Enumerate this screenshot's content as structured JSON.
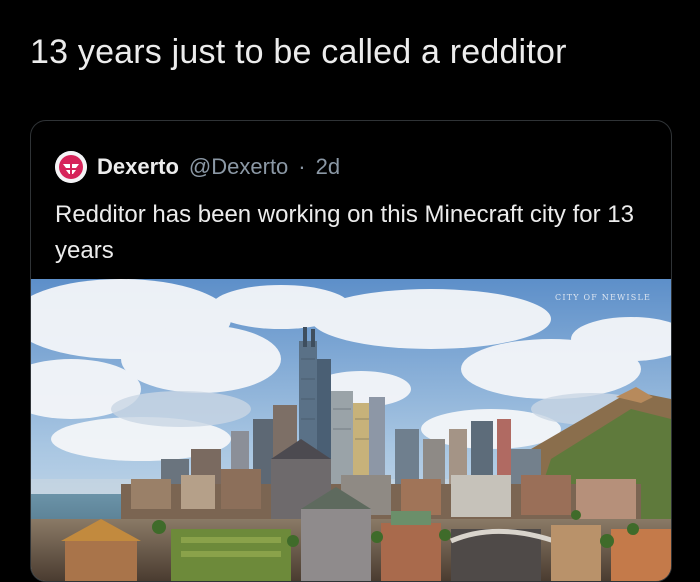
{
  "tweet": {
    "text": "13 years just to be called a redditor"
  },
  "quoted_tweet": {
    "author_display_name": "Dexerto",
    "author_handle": "@Dexerto",
    "separator": "·",
    "time": "2d",
    "text": "Redditor has been working on this Minecraft city for 13 years",
    "avatar_icon": "dexerto-logo-icon",
    "media": {
      "description_icon": "minecraft-city-image",
      "watermark": "CITY OF NEWISLE"
    }
  },
  "colors": {
    "background": "#000000",
    "text": "#ececec",
    "secondary_text": "#8b98a5",
    "card_border": "#2f3336",
    "dexerto_brand": "#d6245a"
  }
}
